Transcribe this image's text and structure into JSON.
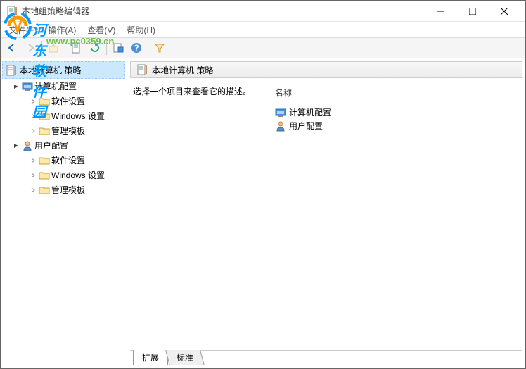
{
  "window": {
    "title": "本地组策略编辑器"
  },
  "menu": {
    "file": "文件(F)",
    "action": "操作(A)",
    "view": "查看(V)",
    "help": "帮助(H)"
  },
  "watermark": {
    "text1": "河东软件园",
    "text2": "www.pc0359.cn"
  },
  "tree": {
    "root": "本地计算机 策略",
    "computer": "计算机配置",
    "software": "软件设置",
    "windows": "Windows 设置",
    "templates": "管理模板",
    "user": "用户配置"
  },
  "detail": {
    "header": "本地计算机 策略",
    "description": "选择一个项目来查看它的描述。",
    "name_header": "名称",
    "item_computer": "计算机配置",
    "item_user": "用户配置"
  },
  "tabs": {
    "extended": "扩展",
    "standard": "标准"
  }
}
